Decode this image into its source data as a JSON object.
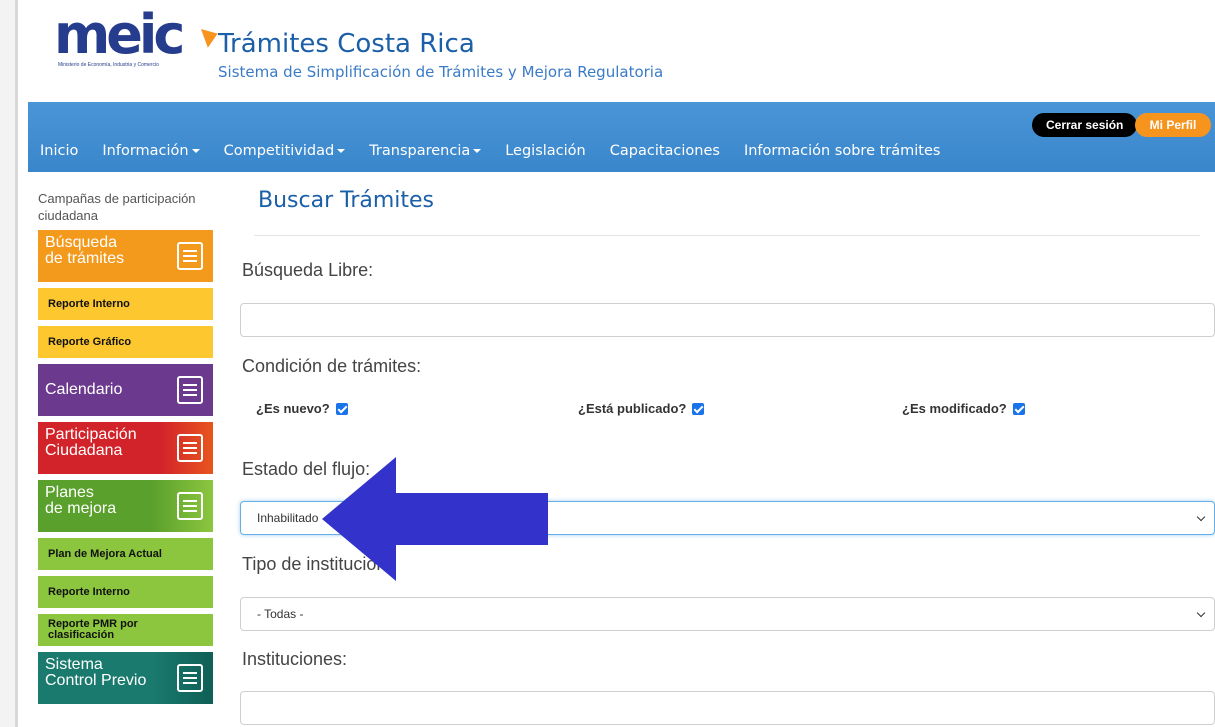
{
  "header": {
    "logo_text": "meic",
    "logo_subtext": "Ministerio de Economía, Industria y Comercio",
    "title": "Trámites Costa Rica",
    "subtitle": "Sistema de Simplificación de Trámites y Mejora Regulatoria"
  },
  "nav": {
    "items": [
      {
        "label": "Inicio",
        "dropdown": false
      },
      {
        "label": "Información",
        "dropdown": true
      },
      {
        "label": "Competitividad",
        "dropdown": true
      },
      {
        "label": "Transparencia",
        "dropdown": true
      },
      {
        "label": "Legislación",
        "dropdown": false
      },
      {
        "label": "Capacitaciones",
        "dropdown": false
      },
      {
        "label": "Información sobre trámites",
        "dropdown": false
      }
    ],
    "logout_label": "Cerrar sesión",
    "profile_label": "Mi Perfil"
  },
  "sidebar": {
    "caption": "Campañas de participación ciudadana",
    "busqueda": {
      "line1": "Búsqueda",
      "line2": "de trámites",
      "color": "#f39a1d"
    },
    "reporte_interno": "Reporte Interno",
    "reporte_grafico": "Reporte Gráfico",
    "calendario": {
      "label": "Calendario",
      "color": "#6b3a8e"
    },
    "participacion": {
      "line1": "Participación",
      "line2": "Ciudadana",
      "color": "#d2232a"
    },
    "planes": {
      "line1": "Planes",
      "line2": "de mejora",
      "color": "#5aa02c"
    },
    "plan_actual": "Plan de Mejora Actual",
    "reporte_interno_2": "Reporte Interno",
    "reporte_pmr_1": "Reporte PMR por",
    "reporte_pmr_2": "clasificación",
    "sistema": {
      "line1": "Sistema",
      "line2": "Control Previo",
      "color": "#1a7a6e"
    }
  },
  "main": {
    "title": "Buscar Trámites",
    "busqueda_libre_label": "Búsqueda Libre:",
    "busqueda_libre_value": "",
    "condicion_label": "Condición de trámites:",
    "checks": [
      {
        "label": "¿Es nuevo?",
        "checked": true
      },
      {
        "label": "¿Está publicado?",
        "checked": true
      },
      {
        "label": "¿Es modificado?",
        "checked": true
      }
    ],
    "estado_label": "Estado del flujo:",
    "estado_value": "Inhabilitado",
    "tipo_label": "Tipo de institución:",
    "tipo_value": "- Todas -",
    "instituciones_label": "Instituciones:",
    "instituciones_value": ""
  },
  "annotation": {
    "arrow_color": "#3333cc"
  }
}
